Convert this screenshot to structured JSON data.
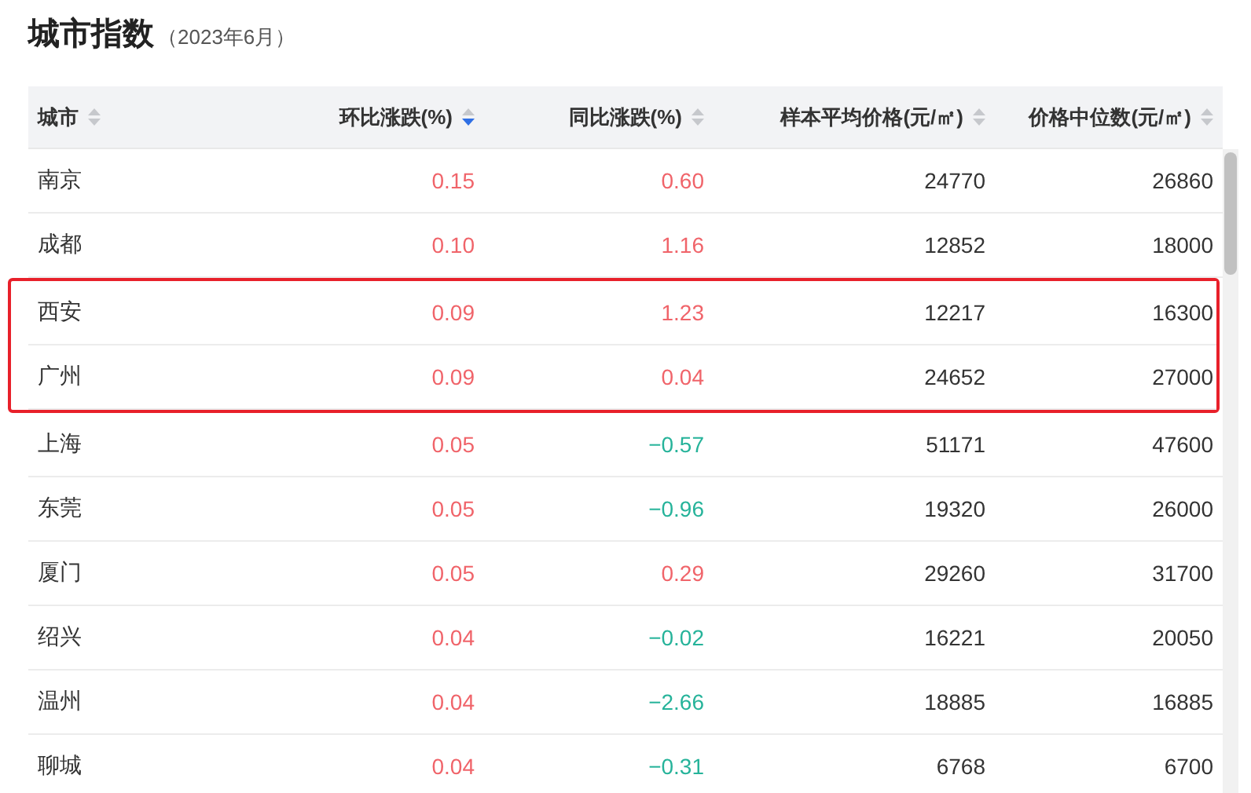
{
  "title": "城市指数",
  "subtitle": "（2023年6月）",
  "columns": [
    {
      "label": "城市",
      "sorted": false,
      "kind": "name"
    },
    {
      "label": "环比涨跌(%)",
      "sorted": true,
      "kind": "number"
    },
    {
      "label": "同比涨跌(%)",
      "sorted": false,
      "kind": "number"
    },
    {
      "label": "样本平均价格(元/㎡)",
      "sorted": false,
      "kind": "number"
    },
    {
      "label": "价格中位数(元/㎡)",
      "sorted": false,
      "kind": "number"
    }
  ],
  "rows": [
    {
      "city": "南京",
      "mom": {
        "text": "0.15",
        "rising": true
      },
      "yoy": {
        "text": "0.60",
        "rising": true
      },
      "avg": "24770",
      "median": "26860",
      "highlighted": false
    },
    {
      "city": "成都",
      "mom": {
        "text": "0.10",
        "rising": true
      },
      "yoy": {
        "text": "1.16",
        "rising": true
      },
      "avg": "12852",
      "median": "18000",
      "highlighted": false
    },
    {
      "city": "西安",
      "mom": {
        "text": "0.09",
        "rising": true
      },
      "yoy": {
        "text": "1.23",
        "rising": true
      },
      "avg": "12217",
      "median": "16300",
      "highlighted": true
    },
    {
      "city": "广州",
      "mom": {
        "text": "0.09",
        "rising": true
      },
      "yoy": {
        "text": "0.04",
        "rising": true
      },
      "avg": "24652",
      "median": "27000",
      "highlighted": true
    },
    {
      "city": "上海",
      "mom": {
        "text": "0.05",
        "rising": true
      },
      "yoy": {
        "text": "−0.57",
        "rising": false
      },
      "avg": "51171",
      "median": "47600",
      "highlighted": false
    },
    {
      "city": "东莞",
      "mom": {
        "text": "0.05",
        "rising": true
      },
      "yoy": {
        "text": "−0.96",
        "rising": false
      },
      "avg": "19320",
      "median": "26000",
      "highlighted": false
    },
    {
      "city": "厦门",
      "mom": {
        "text": "0.05",
        "rising": true
      },
      "yoy": {
        "text": "0.29",
        "rising": true
      },
      "avg": "29260",
      "median": "31700",
      "highlighted": false
    },
    {
      "city": "绍兴",
      "mom": {
        "text": "0.04",
        "rising": true
      },
      "yoy": {
        "text": "−0.02",
        "rising": false
      },
      "avg": "16221",
      "median": "20050",
      "highlighted": false
    },
    {
      "city": "温州",
      "mom": {
        "text": "0.04",
        "rising": true
      },
      "yoy": {
        "text": "−2.66",
        "rising": false
      },
      "avg": "18885",
      "median": "16885",
      "highlighted": false
    },
    {
      "city": "聊城",
      "mom": {
        "text": "0.04",
        "rising": true
      },
      "yoy": {
        "text": "−0.31",
        "rising": false
      },
      "avg": "6768",
      "median": "6700",
      "highlighted": false
    }
  ]
}
